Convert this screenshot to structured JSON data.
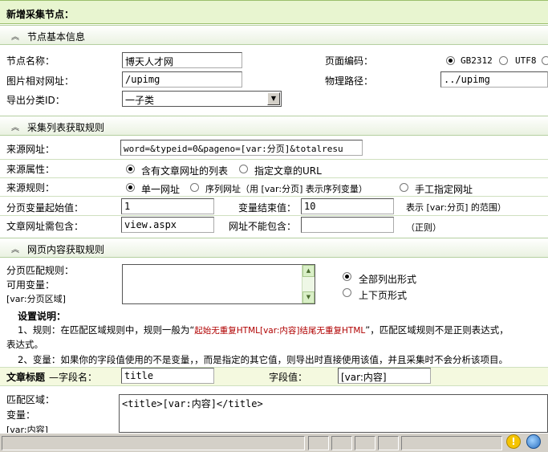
{
  "page_title": "新增采集节点：",
  "sections": {
    "basic": "节点基本信息",
    "list_rules": "采集列表获取规则",
    "content_rules": "网页内容获取规则"
  },
  "basic": {
    "node_name_label": "节点名称：",
    "node_name_value": "博天人才网",
    "encoding_label": "页面编码：",
    "encoding_options": [
      "GB2312",
      "UTF8"
    ],
    "img_url_label": "图片相对网址：",
    "img_url_value": "/upimg",
    "phys_path_label": "物理路径：",
    "phys_path_value": "../upimg",
    "export_cat_label": "导出分类ID：",
    "export_cat_value": "一子类"
  },
  "list": {
    "source_url_label": "来源网址：",
    "source_url_value": "word=&typeid=0&pageno=[var:分页]&totalresu",
    "source_attr_label": "来源属性：",
    "attr_opt1": "含有文章网址的列表",
    "attr_opt2": "指定文章的URL",
    "source_rule_label": "来源规则：",
    "rule_opt1": "单一网址",
    "rule_opt2": "序列网址（用 [var:分页] 表示序列变量）",
    "rule_opt3": "手工指定网址",
    "page_start_label": "分页变量起始值：",
    "page_start_value": "1",
    "page_end_label": "变量结束值：",
    "page_end_value": "10",
    "page_range_note": "表示 [var:分页] 的范围）",
    "must_contain_label": "文章网址需包含：",
    "must_contain_value": "view.aspx",
    "not_contain_label": "网址不能包含：",
    "not_contain_value": "",
    "regex_note": "（正则）"
  },
  "content": {
    "paging_rule_label": "分页匹配规则：",
    "vars_label": "可用变量：",
    "vars_value": "[var:分页区域]",
    "list_mode_opt1": "全部列出形式",
    "list_mode_opt2": "上下页形式",
    "settings_title": "设置说明：",
    "note1_a": "1、规则：在匹配区域规则中，规则一般为“",
    "note1_red": "起始无重复HTML[var:内容]结尾无重复HTML",
    "note1_b": "”，匹配区域规则不是正则表达式，",
    "note1_c": "表达式。",
    "note2": "2、变量：如果你的字段值使用的不是变量，，而是指定的其它值，则导出时直接使用该值，并且采集时不会分析该项目。",
    "field_title_bold": "文章标题",
    "field_name_label": "—字段名：",
    "field_name_value": "title",
    "field_value_label": "字段值：",
    "field_value_value": "[var:内容]",
    "match_area_label": "匹配区域：",
    "var_label": "变量：",
    "var_value": "[var:内容]",
    "match_area_value": "<title>[var:内容]</title>"
  },
  "colors": {
    "title_bar": "#e8f5d0",
    "section_bar": "#eaf2e1",
    "field_row_bg": "#f4f9df",
    "note_red": "#b00000"
  }
}
